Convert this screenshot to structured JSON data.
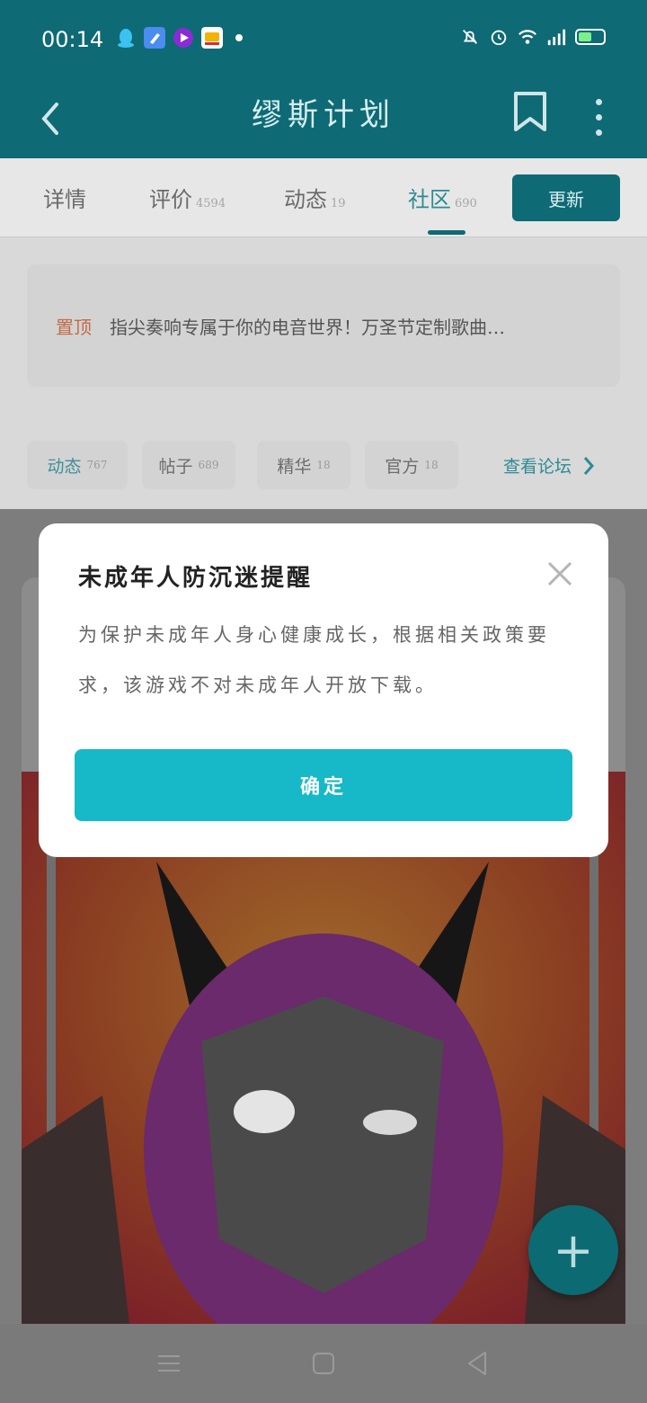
{
  "status": {
    "time": "00:14",
    "notification_icons": [
      "qq-icon",
      "cleaner-icon",
      "video-icon",
      "tv-app-icon"
    ],
    "system_icons": [
      "mute-icon",
      "alarm-icon",
      "wifi-icon",
      "signal-4g-icon",
      "battery-charging-icon"
    ]
  },
  "appbar": {
    "title": "缪斯计划"
  },
  "tabs": [
    {
      "label": "详情",
      "count": ""
    },
    {
      "label": "评价",
      "count": "4594"
    },
    {
      "label": "动态",
      "count": "19"
    },
    {
      "label": "社区",
      "count": "690"
    }
  ],
  "update_button": "更新",
  "pinned": {
    "tag": "置顶",
    "text": "指尖奏响专属于你的电音世界！万圣节定制歌曲…"
  },
  "chips": [
    {
      "label": "动态",
      "count": "767"
    },
    {
      "label": "帖子",
      "count": "689"
    },
    {
      "label": "精华",
      "count": "18"
    },
    {
      "label": "官方",
      "count": "18"
    }
  ],
  "forum_link": "查看论坛",
  "fab": "+",
  "dialog": {
    "title": "未成年人防沉迷提醒",
    "body": "为保护未成年人身心健康成长，根据相关政策要求，该游戏不对未成年人开放下载。",
    "confirm": "确定"
  },
  "colors": {
    "primary": "#0e6a75",
    "accent": "#17b8c7",
    "pinned_tag": "#c46a47"
  }
}
